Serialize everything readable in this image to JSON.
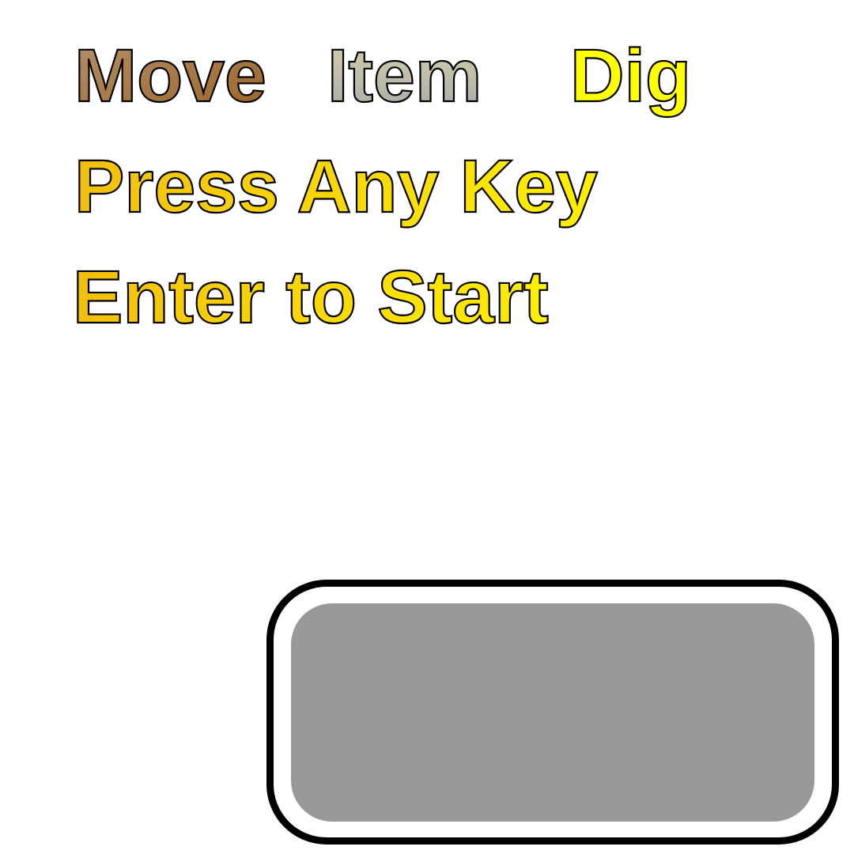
{
  "menu": {
    "move_label": "Move",
    "item_label": "Item",
    "dig_label": "Dig"
  },
  "prompts": {
    "press_any_key": "Press Any Key",
    "enter_to_start": "Enter to Start"
  },
  "colors": {
    "move_gradient": [
      "#b08a60",
      "#9a6428"
    ],
    "item_gradient": [
      "#cfc9a5",
      "#a8a8a8"
    ],
    "gold_gradient": [
      "#f4c20d",
      "#ffee00"
    ],
    "dig_fill": "#ffff00",
    "panel_border": "#000000",
    "panel_fill": "#999999"
  }
}
